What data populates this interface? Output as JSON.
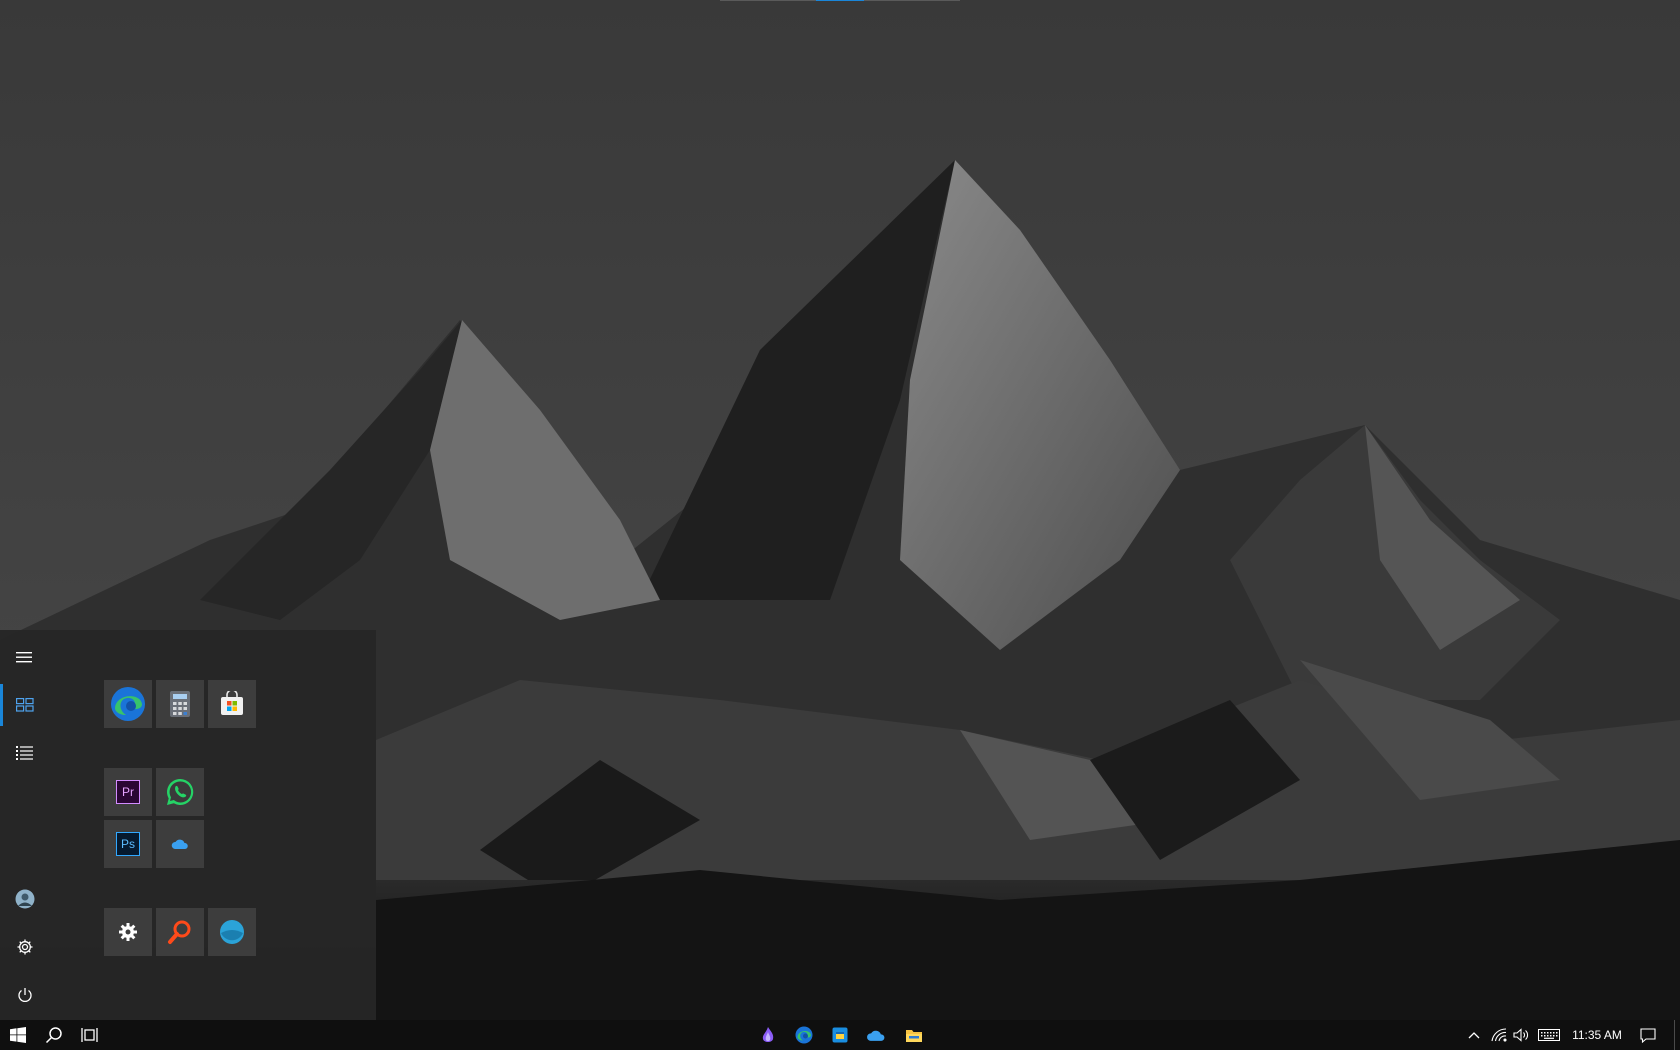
{
  "desktop": {
    "wallpaper": "dark-mountain-landscape"
  },
  "start_menu": {
    "rail": [
      {
        "name": "menu-icon"
      },
      {
        "name": "tiles-icon",
        "active": true
      },
      {
        "name": "all-apps-list-icon"
      },
      {
        "name": "user-avatar"
      },
      {
        "name": "settings-gear-icon"
      },
      {
        "name": "power-icon"
      }
    ],
    "tiles": [
      {
        "name": "edge-tile",
        "icon": "edge-icon"
      },
      {
        "name": "calculator-tile",
        "icon": "calculator-icon"
      },
      {
        "name": "microsoft-store-tile",
        "icon": "store-icon"
      },
      {
        "name": "premiere-pro-tile",
        "icon": "premiere-icon",
        "label": "Pr"
      },
      {
        "name": "whatsapp-tile",
        "icon": "whatsapp-icon"
      },
      {
        "name": "photoshop-tile",
        "icon": "photoshop-icon",
        "label": "Ps"
      },
      {
        "name": "onedrive-tile",
        "icon": "onedrive-icon"
      },
      {
        "name": "settings-tile",
        "icon": "gear-icon"
      },
      {
        "name": "search-app-tile",
        "icon": "magnifier-icon"
      },
      {
        "name": "blue-app-tile",
        "icon": "blue-circle-icon"
      }
    ]
  },
  "taskbar": {
    "start": "windows-logo-icon",
    "search": "search-icon",
    "task_view": "task-view-icon",
    "pinned": [
      "purple-app-icon",
      "edge-icon",
      "calendar-app-icon",
      "onedrive-icon",
      "file-explorer-icon"
    ],
    "tray": [
      "chevron-up-icon",
      "network-icon",
      "volume-icon",
      "keyboard-icon"
    ],
    "clock": "11:35 AM",
    "notifications": "action-center-icon"
  },
  "colors": {
    "accent": "#1a86d9",
    "taskbar_bg": "#0f0f0f",
    "menu_bg": "#262626",
    "tile_bg": "#3d3d3d"
  }
}
